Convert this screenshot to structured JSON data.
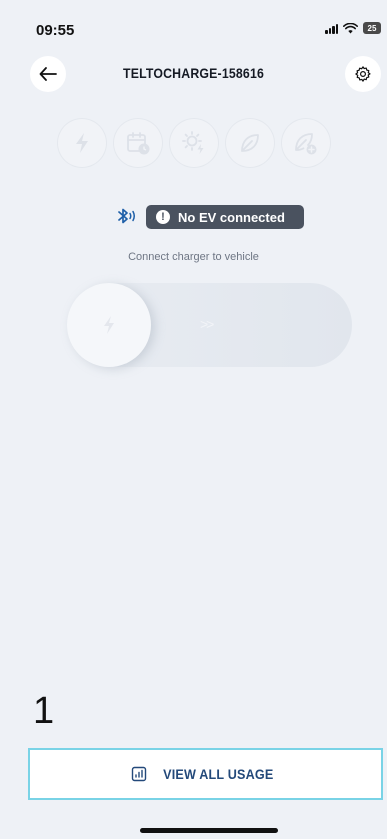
{
  "status_bar": {
    "time": "09:55",
    "battery": "25",
    "icons": [
      "signal-icon",
      "wifi-icon",
      "battery-icon"
    ]
  },
  "header": {
    "title": "TELTOCHARGE-158616",
    "back_icon": "arrow-left-icon",
    "settings_icon": "gear-icon"
  },
  "modes": [
    {
      "name": "bolt-icon",
      "state": "disabled"
    },
    {
      "name": "schedule-icon",
      "state": "disabled"
    },
    {
      "name": "sun-bolt-icon",
      "state": "disabled"
    },
    {
      "name": "leaf-icon",
      "state": "disabled"
    },
    {
      "name": "leaf-add-icon",
      "state": "disabled"
    }
  ],
  "connection": {
    "bluetooth_icon": "bluetooth-connected-icon",
    "status": "No EV connected",
    "hint": "Connect charger to vehicle"
  },
  "slider": {
    "knob_icon": "bolt-icon",
    "arrows": ">>",
    "state": "disabled"
  },
  "index_marker": "1",
  "usage_button": {
    "label": "VIEW ALL USAGE",
    "icon": "bar-chart-icon"
  },
  "colors": {
    "background": "#eef1f6",
    "pill": "#4a525f",
    "accent_text": "#23497a",
    "button_outline": "#79d3e6",
    "bluetooth": "#1e5fa8"
  }
}
